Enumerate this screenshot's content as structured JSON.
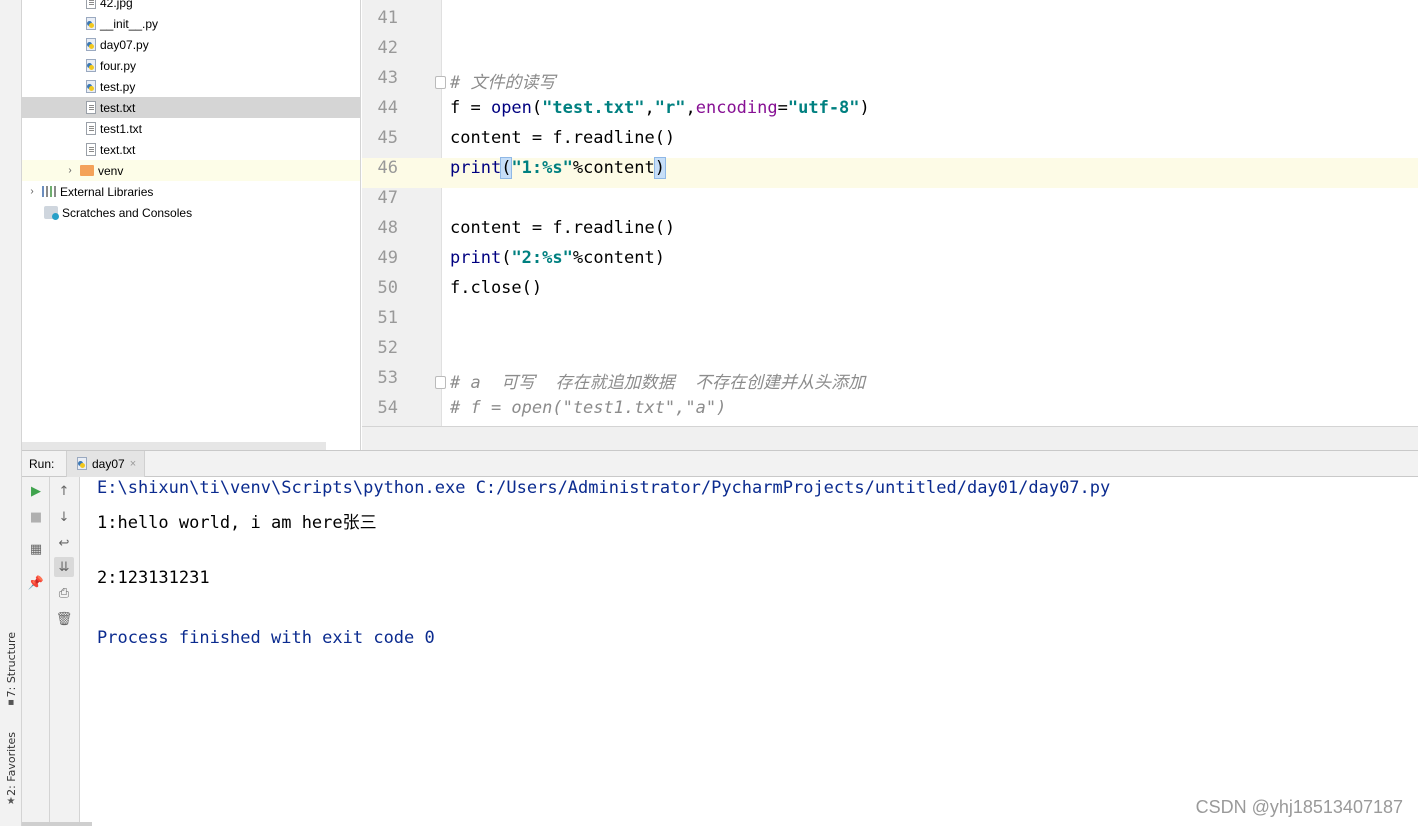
{
  "project_tree": {
    "items": [
      {
        "label": "42.jpg",
        "type": "txt",
        "indent": 3
      },
      {
        "label": "__init__.py",
        "type": "py",
        "indent": 3
      },
      {
        "label": "day07.py",
        "type": "py",
        "indent": 3
      },
      {
        "label": "four.py",
        "type": "py",
        "indent": 3
      },
      {
        "label": "test.py",
        "type": "py",
        "indent": 3
      },
      {
        "label": "test.txt",
        "type": "txt",
        "indent": 3,
        "selected": true
      },
      {
        "label": "test1.txt",
        "type": "txt",
        "indent": 3
      },
      {
        "label": "text.txt",
        "type": "txt",
        "indent": 3
      },
      {
        "label": "venv",
        "type": "folder",
        "indent": 2,
        "arrow": "›",
        "highlight": true
      },
      {
        "label": "External Libraries",
        "type": "libs",
        "indent": 0,
        "arrow": "›"
      },
      {
        "label": "Scratches and Consoles",
        "type": "scratch",
        "indent": 1
      }
    ]
  },
  "editor": {
    "lines": [
      {
        "num": "41",
        "html": ""
      },
      {
        "num": "42",
        "html": ""
      },
      {
        "num": "43",
        "fold": true,
        "html": "<span class=\"c-cm\"># 文件的读写</span>"
      },
      {
        "num": "44",
        "html": "f = <span class=\"c-bi\">open</span>(<span class=\"c-str\">\"test.txt\"</span>,<span class=\"c-str\">\"r\"</span>,<span class=\"c-kw\">encoding</span>=<span class=\"c-str\">\"utf-8\"</span>)"
      },
      {
        "num": "45",
        "html": "content = f.readline()"
      },
      {
        "num": "46",
        "current": true,
        "html": "<span class=\"c-bi\">print</span><span class=\"c-bracket\">(</span><span class=\"c-str\">\"1:%s\"</span>%content<span class=\"c-bracket\">)</span>"
      },
      {
        "num": "47",
        "html": ""
      },
      {
        "num": "48",
        "html": "content = f.readline()"
      },
      {
        "num": "49",
        "html": "<span class=\"c-bi\">print</span>(<span class=\"c-str\">\"2:%s\"</span>%content)"
      },
      {
        "num": "50",
        "html": "f.close()"
      },
      {
        "num": "51",
        "html": ""
      },
      {
        "num": "52",
        "html": ""
      },
      {
        "num": "53",
        "fold": true,
        "html": "<span class=\"c-cm\"># a  可写  存在就追加数据  不存在创建并从头添加</span>"
      },
      {
        "num": "54",
        "html": "<span class=\"c-cm\"># f = open(\"test1.txt\",\"a\")</span>"
      }
    ]
  },
  "run": {
    "label": "Run:",
    "tab_label": "day07",
    "close": "×"
  },
  "console": {
    "lines": [
      {
        "text": "E:\\shixun\\ti\\venv\\Scripts\\python.exe C:/Users/Administrator/PycharmProjects/untitled/day01/day07.py",
        "kind": "sys"
      },
      {
        "text": "1:hello world, i am here张三",
        "kind": "out"
      },
      {
        "text": "",
        "kind": "out"
      },
      {
        "text": "2:123131231",
        "kind": "out"
      },
      {
        "text": "",
        "kind": "out"
      },
      {
        "text": "Process finished with exit code 0",
        "kind": "sys"
      }
    ]
  },
  "side_tabs": {
    "structure": "7: Structure",
    "favorites": "2: Favorites"
  },
  "watermark": "CSDN @yhj18513407187",
  "colors": {
    "accent": "#0b2b8f",
    "string": "#008080",
    "current_line": "#fdfbe6"
  }
}
